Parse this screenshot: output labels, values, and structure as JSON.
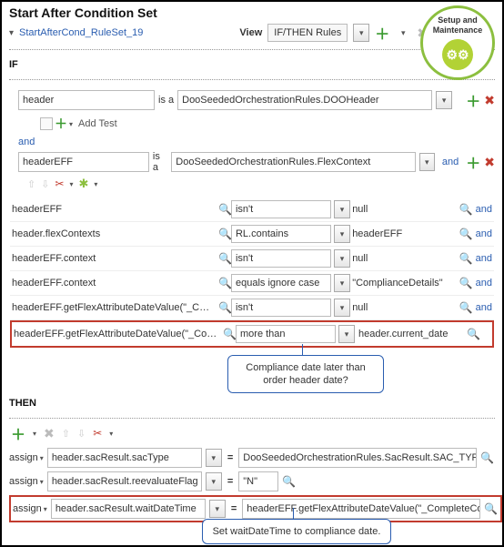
{
  "header": {
    "title": "Start After Condition Set",
    "ruleset_name": "StartAfterCond_RuleSet_19",
    "view_label": "View",
    "view_mode": "IF/THEN Rules"
  },
  "setup_badge": {
    "line1": "Setup and",
    "line2": "Maintenance"
  },
  "if": {
    "label": "IF",
    "cond1_left": "header",
    "is_a": "is a",
    "cond1_right": "DooSeededOrchestrationRules.DOOHeader",
    "add_test": "Add Test",
    "and": "and",
    "cond2_left": "headerEFF",
    "cond2_right": "DooSeededOrchestrationRules.FlexContext",
    "rows": [
      {
        "left": "headerEFF",
        "op": "isn't",
        "val": "null",
        "trail": "and"
      },
      {
        "left": "header.flexContexts",
        "op": "RL.contains",
        "val": "headerEFF",
        "trail": "and"
      },
      {
        "left": "headerEFF.context",
        "op": "isn't",
        "val": "null",
        "trail": "and"
      },
      {
        "left": "headerEFF.context",
        "op": "equals ignore case",
        "val": "\"ComplianceDetails\"",
        "trail": "and"
      },
      {
        "left": "headerEFF.getFlexAttributeDateValue(\"_CompleteCo",
        "op": "isn't",
        "val": "null",
        "trail": "and"
      },
      {
        "left": "headerEFF.getFlexAttributeDateValue(\"_CompleteCo",
        "op": "more than",
        "val": "header.current_date",
        "trail": ""
      }
    ]
  },
  "callout_if": {
    "line1": "Compliance date later than",
    "line2": "order header date?"
  },
  "then": {
    "label": "THEN",
    "assign_label": "assign",
    "rows": [
      {
        "field": "header.sacResult.sacType",
        "value": "DooSeededOrchestrationRules.SacResult.SAC_TYP"
      },
      {
        "field": "header.sacResult.reevaluateFlag",
        "value": "\"N\""
      },
      {
        "field": "header.sacResult.waitDateTime",
        "value": "headerEFF.getFlexAttributeDateValue(\"_CompleteCo"
      }
    ]
  },
  "callout_then": "Set waitDateTime to compliance date."
}
